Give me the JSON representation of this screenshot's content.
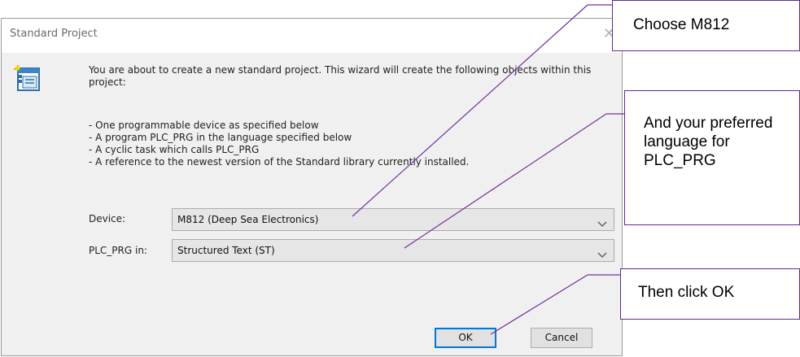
{
  "dialog": {
    "title": "Standard Project",
    "close_glyph": "✕",
    "icon": "wizard-window-icon",
    "intro": "You are about to create a new standard project. This wizard will create the following objects within this project:",
    "bullets": [
      "- One programmable device as specified below",
      "- A program PLC_PRG in the language specified below",
      "- A cyclic task which calls PLC_PRG",
      "- A reference to the newest version of the Standard library currently installed."
    ],
    "device_label": "Device:",
    "device_value": "M812 (Deep Sea Electronics)",
    "plc_label": "PLC_PRG in:",
    "plc_value": "Structured Text (ST)",
    "ok_label": "OK",
    "cancel_label": "Cancel"
  },
  "callouts": {
    "device": "Choose M812",
    "language": "And your preferred language for PLC_PRG",
    "ok": "Then click OK",
    "border_color": "#5b2d8e",
    "line_color": "#7030a0"
  }
}
